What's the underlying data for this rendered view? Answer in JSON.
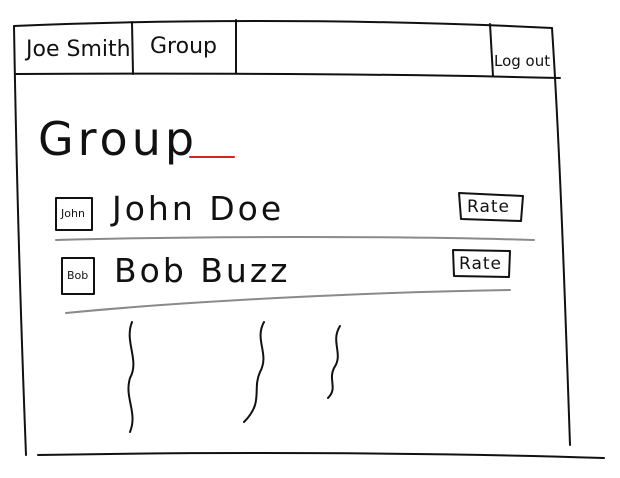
{
  "tabs": {
    "user_name": "Joe Smith",
    "group": "Group",
    "logout": "Log out"
  },
  "page": {
    "title": "Group"
  },
  "members": [
    {
      "avatar_label": "John",
      "name": "John Doe",
      "action_label": "Rate"
    },
    {
      "avatar_label": "Bob",
      "name": "Bob Buzz",
      "action_label": "Rate"
    }
  ],
  "colors": {
    "ink": "#111111",
    "divider": "#8a8a8a",
    "underline_accent": "#e02020"
  }
}
